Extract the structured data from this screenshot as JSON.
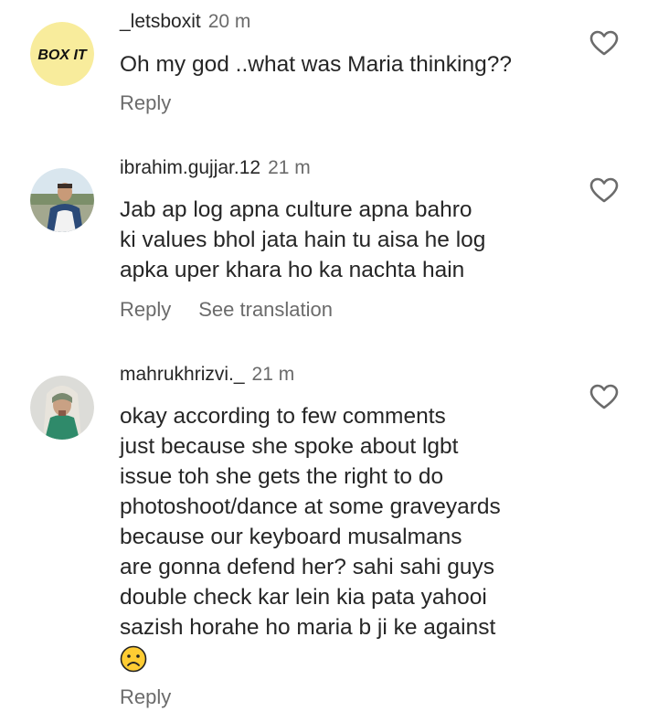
{
  "comments": [
    {
      "username": "_letsboxit",
      "time": "20 m",
      "avatar_text": "BOX IT",
      "lines": [
        "Oh my god ..what was Maria thinking??"
      ],
      "reply_label": "Reply",
      "like_icon": "heart-outline-icon"
    },
    {
      "username": "ibrahim.gujjar.12",
      "time": "21 m",
      "lines": [
        "Jab ap log apna culture apna bahro",
        "ki values bhol jata hain tu aisa he log",
        "apka uper khara ho ka nachta hain"
      ],
      "reply_label": "Reply",
      "translation_label": "See translation",
      "like_icon": "heart-outline-icon"
    },
    {
      "username": "mahrukhrizvi._",
      "time": "21 m",
      "lines": [
        "okay according to few comments",
        "just because she spoke about lgbt",
        "issue toh she gets the right to do",
        "photoshoot/dance at some graveyards",
        "because our keyboard musalmans",
        "are gonna defend her? sahi sahi guys",
        "double check kar lein kia pata yahooi",
        "sazish horahe ho maria b ji ke against"
      ],
      "emoji": "sad-face-emoji",
      "reply_label": "Reply",
      "like_icon": "heart-outline-icon"
    }
  ],
  "colors": {
    "text": "#262626",
    "secondary": "#6b6b6b",
    "boxit_avatar": "#f8ec9c"
  }
}
